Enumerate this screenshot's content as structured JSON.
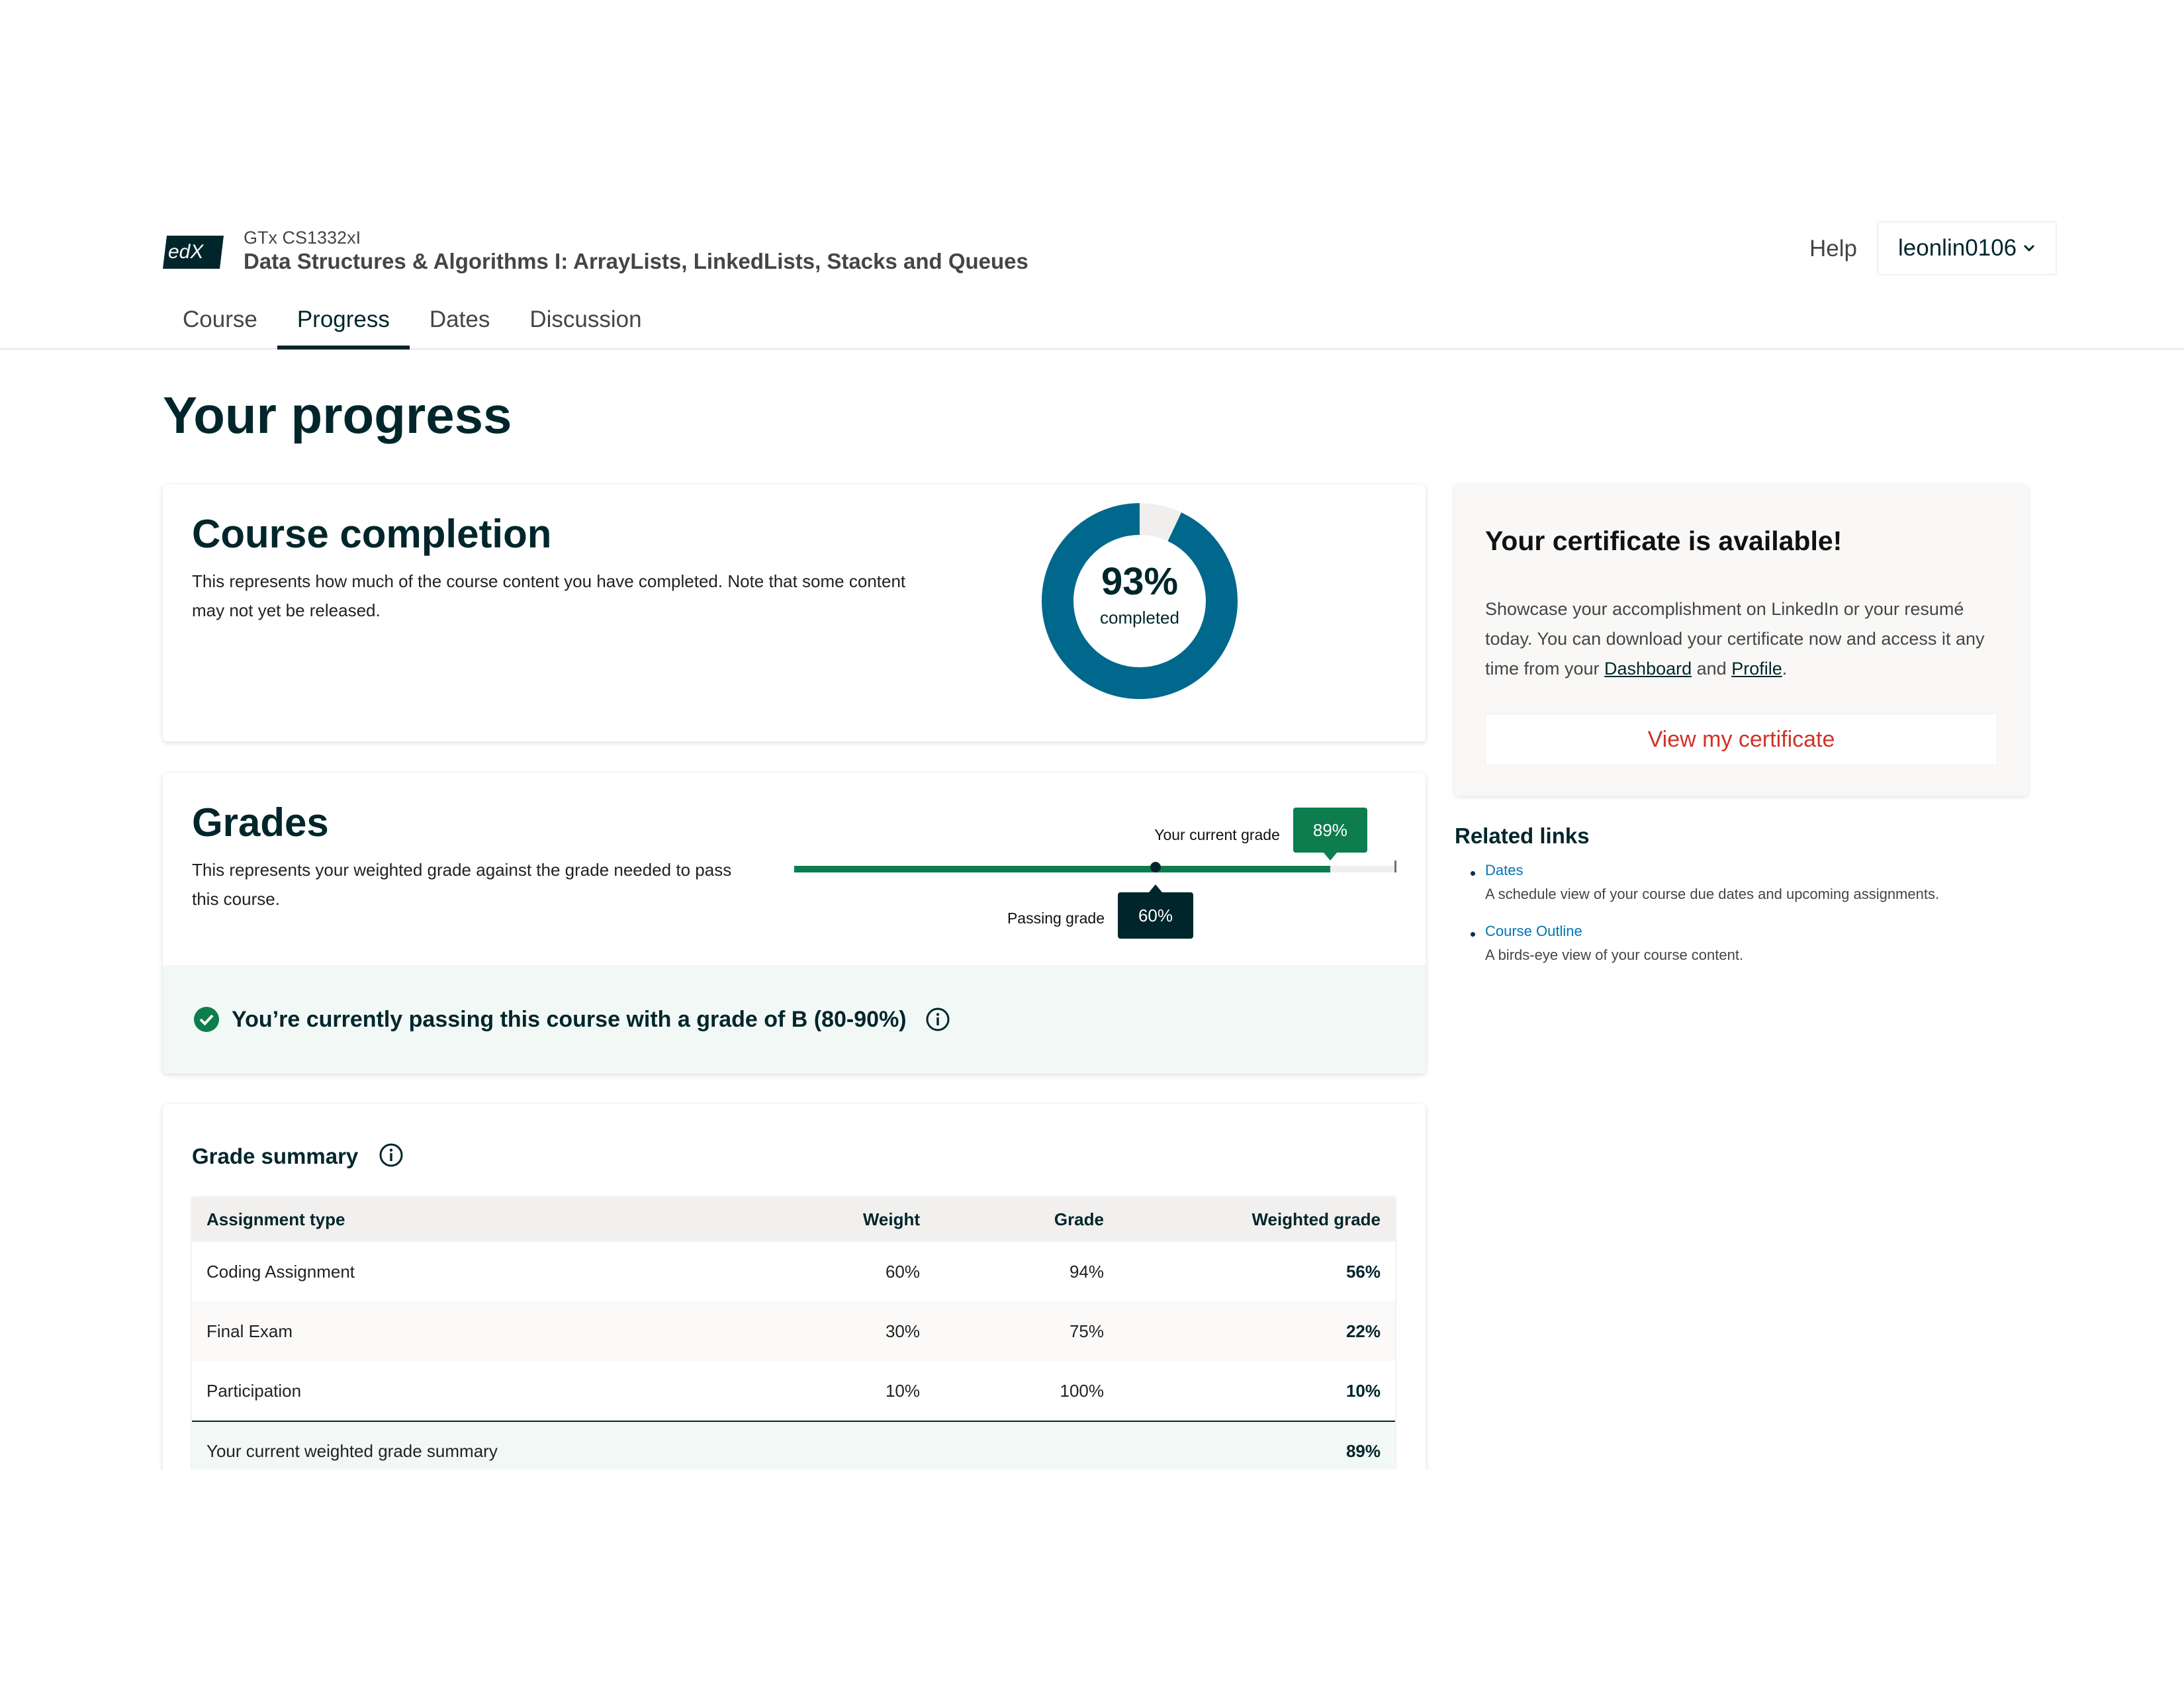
{
  "header": {
    "logo_text": "edX",
    "org_code": "GTx CS1332xI",
    "course_title": "Data Structures & Algorithms I: ArrayLists, LinkedLists, Stacks and Queues",
    "help_label": "Help",
    "username": "leonlin0106"
  },
  "tabs": [
    {
      "label": "Course",
      "active": false
    },
    {
      "label": "Progress",
      "active": true
    },
    {
      "label": "Dates",
      "active": false
    },
    {
      "label": "Discussion",
      "active": false
    }
  ],
  "page_title": "Your progress",
  "completion": {
    "title": "Course completion",
    "description": "This represents how much of the course content you have completed. Note that some content may not yet be released.",
    "percent_label": "93%",
    "percent_value": 93,
    "completed_label": "completed",
    "color_complete": "#00688d",
    "color_remaining": "#f0efed"
  },
  "grades": {
    "title": "Grades",
    "description": "This represents your weighted grade against the grade needed to pass this course.",
    "current_label": "Your current grade",
    "current_value": "89%",
    "current_fraction": 0.89,
    "passing_label": "Passing grade",
    "passing_value": "60%",
    "passing_fraction": 0.6,
    "banner_message": "You’re currently passing this course with a grade of B (80-90%)",
    "accent": "#0d7d4d"
  },
  "summary": {
    "title": "Grade summary",
    "columns": [
      "Assignment type",
      "Weight",
      "Grade",
      "Weighted grade"
    ],
    "rows": [
      {
        "type": "Coding Assignment",
        "weight": "60%",
        "grade": "94%",
        "weighted": "56%"
      },
      {
        "type": "Final Exam",
        "weight": "30%",
        "grade": "75%",
        "weighted": "22%"
      },
      {
        "type": "Participation",
        "weight": "10%",
        "grade": "100%",
        "weighted": "10%"
      }
    ],
    "total_label": "Your current weighted grade summary",
    "total_value": "89%"
  },
  "certificate": {
    "title": "Your certificate is available!",
    "text_before": "Showcase your accomplishment on LinkedIn or your resumé today. You can download your certificate now and access it any time from your ",
    "dashboard_link": "Dashboard",
    "and_text": " and ",
    "profile_link": "Profile",
    "period": ".",
    "button_label": "View my certificate"
  },
  "related": {
    "title": "Related links",
    "links": [
      {
        "label": "Dates",
        "description": "A schedule view of your course due dates and upcoming assignments."
      },
      {
        "label": "Course Outline",
        "description": "A birds-eye view of your course content."
      }
    ]
  }
}
